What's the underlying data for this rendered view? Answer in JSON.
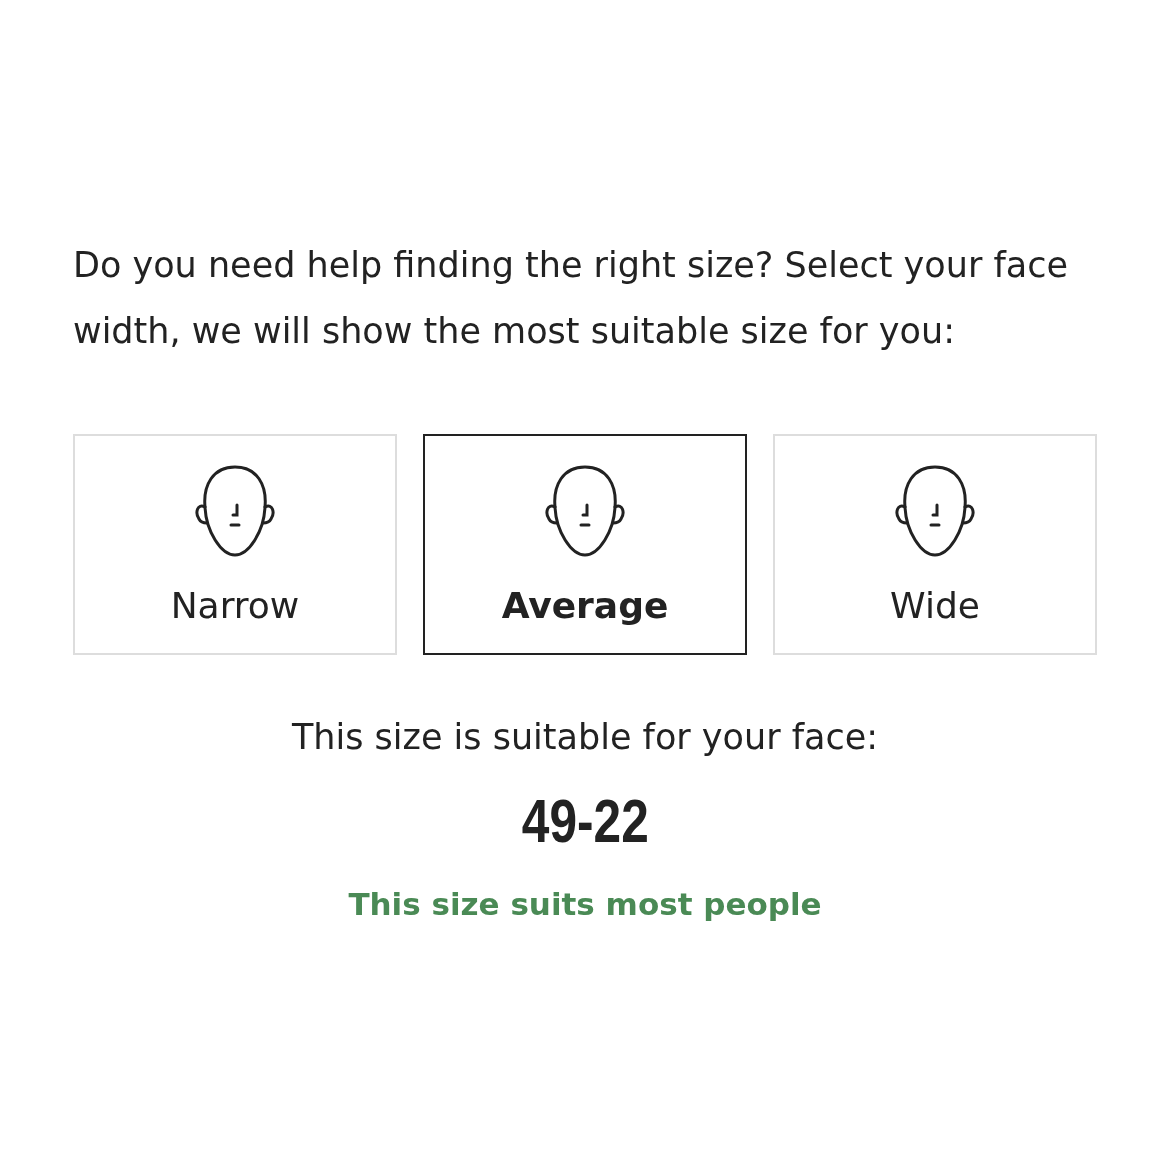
{
  "prompt": "Do you need help finding the right size? Select your face width, we will show the most suitable size for you:",
  "options": [
    {
      "label": "Narrow",
      "selected": false
    },
    {
      "label": "Average",
      "selected": true
    },
    {
      "label": "Wide",
      "selected": false
    }
  ],
  "result": {
    "caption": "This size is suitable for your face:",
    "size": "49-22",
    "note": "This size suits most people"
  }
}
